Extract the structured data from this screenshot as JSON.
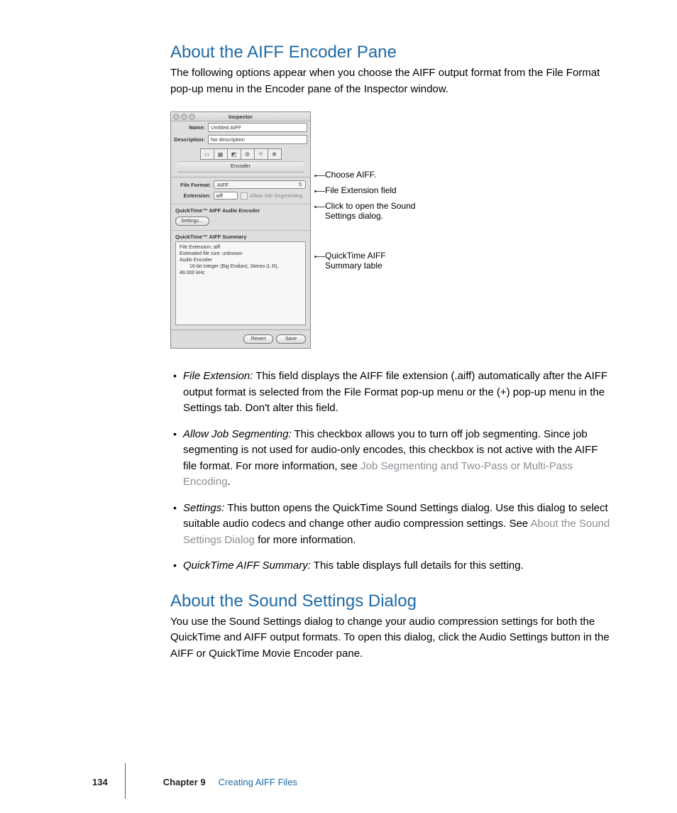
{
  "heading1": "About the AIFF Encoder Pane",
  "intro1": "The following options appear when you choose the AIFF output format from the File Format pop-up menu in the Encoder pane of the Inspector window.",
  "inspector": {
    "title": "Inspector",
    "name_label": "Name:",
    "name_value": "Untitled AIFF",
    "desc_label": "Description:",
    "desc_value": "No description",
    "encoder_label": "Encoder",
    "file_format_label": "File Format:",
    "file_format_value": "AIFF",
    "extension_label": "Extension:",
    "extension_value": "aiff",
    "allow_job_seg": "Allow Job Segmenting",
    "audio_encoder_head": "QuickTime™ AIFF Audio Encoder",
    "settings_btn": "Settings…",
    "summary_head": "QuickTime™ AIFF Summary",
    "summary_l1": "File Extension: aiff",
    "summary_l2": "Estimated file size: unknown",
    "summary_l3": "Audio Encoder",
    "summary_l4": "16-bit Integer (Big Endian), Stereo (L R),",
    "summary_l5": "48.000 kHz",
    "revert_btn": "Revert",
    "save_btn": "Save"
  },
  "callouts": {
    "c1": "Choose AIFF.",
    "c2": "File Extension field",
    "c3a": "Click to open the Sound",
    "c3b": "Settings dialog.",
    "c4a": "QuickTime AIFF",
    "c4b": "Summary table"
  },
  "bullets": {
    "b1_term": "File Extension:",
    "b1_text": "  This field displays the AIFF file extension (.aiff) automatically after the AIFF output format is selected from the File Format pop-up menu or the (+) pop-up menu in the Settings tab. Don't alter this field.",
    "b2_term": "Allow Job Segmenting:",
    "b2_text1": "  This checkbox allows you to turn off job segmenting. Since job segmenting is not used for audio-only encodes, this checkbox is not active with the AIFF file format. For more information, see ",
    "b2_link": "Job Segmenting and Two-Pass or Multi-Pass Encoding",
    "b2_text2": ".",
    "b3_term": "Settings:",
    "b3_text1": "  This button opens the QuickTime Sound Settings dialog. Use this dialog to select suitable audio codecs and change other audio compression settings. See ",
    "b3_link": "About the Sound Settings Dialog",
    "b3_text2": " for more information.",
    "b4_term": "QuickTime AIFF Summary:",
    "b4_text": "  This table displays full details for this setting."
  },
  "heading2": "About the Sound Settings Dialog",
  "intro2": "You use the Sound Settings dialog to change your audio compression settings for both the QuickTime and AIFF output formats. To open this dialog, click the Audio Settings button in the AIFF or QuickTime Movie Encoder pane.",
  "footer": {
    "page": "134",
    "chapter": "Chapter 9",
    "title": "Creating AIFF Files"
  }
}
